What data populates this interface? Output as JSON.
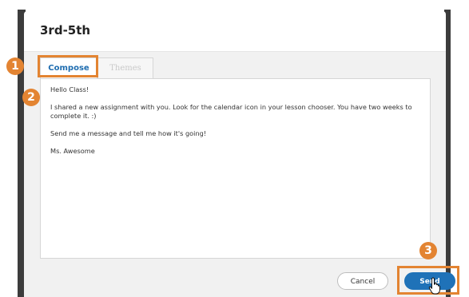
{
  "dialog": {
    "title": "3rd-5th"
  },
  "tabs": [
    {
      "label": "Compose",
      "active": true
    },
    {
      "label": "Themes",
      "active": false
    }
  ],
  "message": {
    "lines": [
      "Hello Class!",
      "I shared a new assignment with you. Look for the calendar icon in your lesson chooser. You have two weeks to complete it. :)",
      "Send me a message and tell me how it's going!",
      "Ms. Awesome"
    ]
  },
  "buttons": {
    "cancel_label": "Cancel",
    "send_label": "Send"
  },
  "steps": {
    "one": "1",
    "two": "2",
    "three": "3"
  },
  "colors": {
    "accent": "#e38432",
    "primary": "#1f72b8",
    "active_tab_text": "#1f6db0"
  },
  "icons": {
    "cursor": "hand-pointer-icon"
  }
}
